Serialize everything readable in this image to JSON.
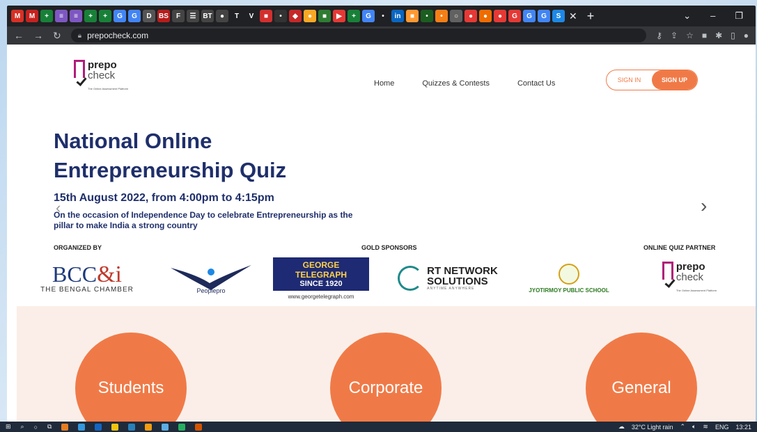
{
  "browser": {
    "url": "prepocheck.com",
    "tab_icons": [
      {
        "name": "gmail-icon",
        "color": "#d93025",
        "glyph": "M"
      },
      {
        "name": "gmail-icon",
        "color": "#c5221f",
        "glyph": "M"
      },
      {
        "name": "sheets-icon",
        "color": "#188038",
        "glyph": "+"
      },
      {
        "name": "forms-icon",
        "color": "#7e57c2",
        "glyph": "≡"
      },
      {
        "name": "forms-icon",
        "color": "#7e57c2",
        "glyph": "≡"
      },
      {
        "name": "sheets-icon",
        "color": "#188038",
        "glyph": "+"
      },
      {
        "name": "sheets-icon",
        "color": "#188038",
        "glyph": "+"
      },
      {
        "name": "google-icon",
        "color": "#4285f4",
        "glyph": "G"
      },
      {
        "name": "google-icon",
        "color": "#4285f4",
        "glyph": "G"
      },
      {
        "name": "doc-icon",
        "color": "#555555",
        "glyph": "D"
      },
      {
        "name": "bs-icon",
        "color": "#b71c1c",
        "glyph": "BS"
      },
      {
        "name": "f-icon",
        "color": "#444444",
        "glyph": "F"
      },
      {
        "name": "news-icon",
        "color": "#444444",
        "glyph": "☰"
      },
      {
        "name": "bt-icon",
        "color": "#444444",
        "glyph": "BT"
      },
      {
        "name": "news-icon",
        "color": "#444444",
        "glyph": "●"
      },
      {
        "name": "t-icon",
        "color": "#202124",
        "glyph": "T"
      },
      {
        "name": "v-icon",
        "color": "#202124",
        "glyph": "V"
      },
      {
        "name": "red-icon",
        "color": "#d32f2f",
        "glyph": "■"
      },
      {
        "name": "app-icon",
        "color": "#333333",
        "glyph": "•"
      },
      {
        "name": "app-icon",
        "color": "#c62828",
        "glyph": "◆"
      },
      {
        "name": "app-icon",
        "color": "#f9a825",
        "glyph": "●"
      },
      {
        "name": "app-icon",
        "color": "#2e7d32",
        "glyph": "■"
      },
      {
        "name": "youtube-icon",
        "color": "#e53935",
        "glyph": "▶"
      },
      {
        "name": "sheets-icon",
        "color": "#188038",
        "glyph": "+"
      },
      {
        "name": "google-icon",
        "color": "#4285f4",
        "glyph": "G"
      },
      {
        "name": "app-icon",
        "color": "#202124",
        "glyph": "•"
      },
      {
        "name": "linkedin-icon",
        "color": "#0a66c2",
        "glyph": "in"
      },
      {
        "name": "flag-icon",
        "color": "#ff9933",
        "glyph": "■"
      },
      {
        "name": "app-icon",
        "color": "#1b5e20",
        "glyph": "•"
      },
      {
        "name": "app-icon",
        "color": "#f57f17",
        "glyph": "•"
      },
      {
        "name": "app-icon",
        "color": "#616161",
        "glyph": "○"
      },
      {
        "name": "app-icon",
        "color": "#e53935",
        "glyph": "●"
      },
      {
        "name": "app-icon",
        "color": "#ef6c00",
        "glyph": "●"
      },
      {
        "name": "app-icon",
        "color": "#e53935",
        "glyph": "●"
      },
      {
        "name": "app-icon",
        "color": "#e53935",
        "glyph": "G"
      },
      {
        "name": "google-icon",
        "color": "#4285f4",
        "glyph": "G"
      },
      {
        "name": "google-icon",
        "color": "#4285f4",
        "glyph": "G"
      },
      {
        "name": "app-icon",
        "color": "#1e88e5",
        "glyph": "S"
      }
    ]
  },
  "site": {
    "logo": {
      "word1": "prepo",
      "word2": "check",
      "tagline": "The Online Assessment Platform"
    },
    "nav": [
      "Home",
      "Quizzes & Contests",
      "Contact Us"
    ],
    "signin": "SIGN IN",
    "signup": "SIGN UP",
    "hero": {
      "title": "National Online Entrepreneurship Quiz",
      "date": "15th  August 2022, from 4:00pm to 4:15pm",
      "subtitle": "On the occasion of Independence Day to celebrate Entrepreneurship as the pillar to make India a strong country"
    },
    "headings": {
      "organized": "ORGANIZED BY",
      "gold": "GOLD SPONSORS",
      "partner": "ONLINE QUIZ PARTNER"
    },
    "sponsors": {
      "bcc_main": "BCC",
      "bcc_amp": "&i",
      "bcc_sub": "THE BENGAL CHAMBER",
      "peoplepro": "Peoplepro",
      "george_1": "GEORGE TELEGRAPH",
      "george_2": "SINCE 1920",
      "george_url": "www.georgetelegraph.com",
      "rt_1": "RT NETWORK",
      "rt_2": "SOLUTIONS",
      "rt_sub": "ANYTIME ANYWHERE",
      "jps": "JYOTIRMOY PUBLIC SCHOOL"
    },
    "audience": [
      "Students",
      "Corporate",
      "General"
    ]
  },
  "taskbar": {
    "weather": "32°C  Light rain",
    "lang": "ENG",
    "time": "13:21"
  }
}
